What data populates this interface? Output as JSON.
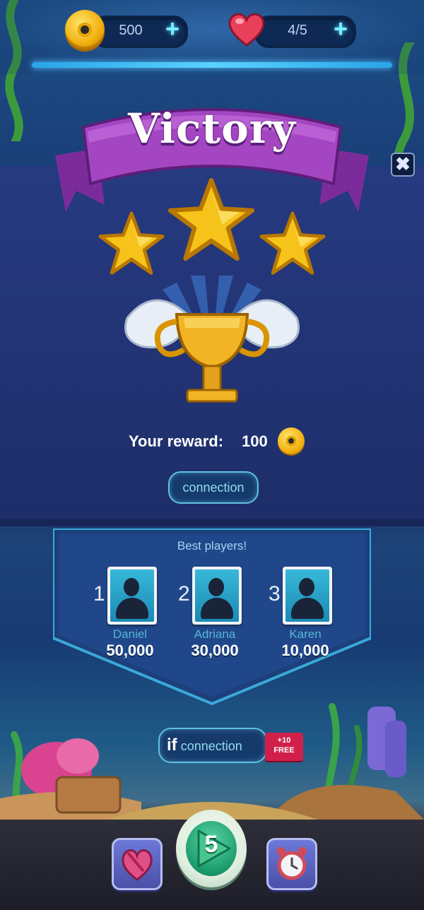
{
  "top_bar": {
    "coins": "500",
    "lives": "4/5",
    "add_icon": "+"
  },
  "victory": {
    "title": "Victory",
    "stars_earned": 3,
    "reward_label": "Your reward:",
    "reward_value": "100",
    "connection_label": "connection",
    "close_icon": "✖"
  },
  "leaderboard": {
    "title": "Best players!",
    "players": [
      {
        "rank": "1",
        "name": "Daniel",
        "score": "50,000"
      },
      {
        "rank": "2",
        "name": "Adriana",
        "score": "30,000"
      },
      {
        "rank": "3",
        "name": "Karen",
        "score": "10,000"
      }
    ]
  },
  "bottom": {
    "if_label": "if",
    "connection_label": "connection",
    "free_badge_top": "+10",
    "free_badge_bottom": "FREE",
    "play_level": "5"
  },
  "colors": {
    "accent_cyan": "#5fc3e0",
    "banner_purple": "#9a3fb5",
    "gold": "#f2b212"
  }
}
